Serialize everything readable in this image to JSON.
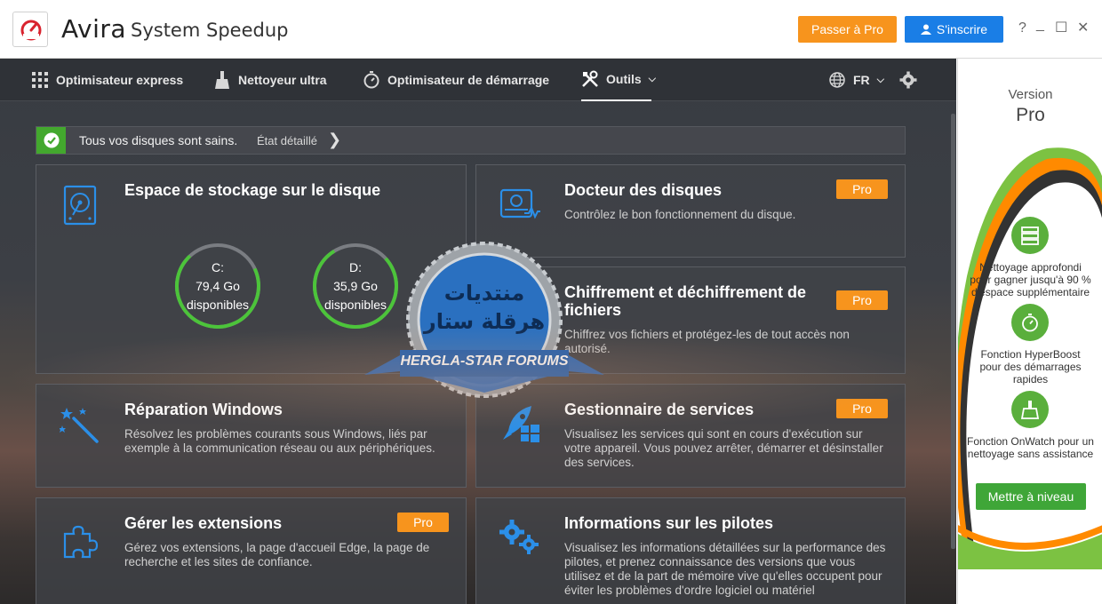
{
  "titlebar": {
    "brand": "Avira",
    "product": "System Speedup",
    "pro_button": "Passer à Pro",
    "signup_button": "S'inscrire",
    "help": "?",
    "minimize": "_",
    "maximize": "☐",
    "close": "✕"
  },
  "nav": {
    "items": [
      {
        "label": "Optimisateur express",
        "icon": "grid-icon"
      },
      {
        "label": "Nettoyeur ultra",
        "icon": "broom-icon"
      },
      {
        "label": "Optimisateur de démarrage",
        "icon": "stopwatch-icon"
      },
      {
        "label": "Outils",
        "icon": "tools-icon",
        "active": true
      }
    ],
    "language": "FR"
  },
  "status": {
    "text": "Tous vos disques sont sains.",
    "link": "État détaillé"
  },
  "cards": {
    "storage": {
      "title": "Espace de stockage sur le disque",
      "disks": [
        {
          "label": "C:",
          "free": "79,4 Go",
          "caption": "disponibles",
          "fill_fraction": 0.3
        },
        {
          "label": "D:",
          "free": "35,9 Go",
          "caption": "disponibles",
          "fill_fraction": 0.22
        }
      ]
    },
    "doctor": {
      "title": "Docteur des disques",
      "desc": "Contrôlez le bon fonctionnement du disque.",
      "badge": "Pro"
    },
    "encryption": {
      "title": "Chiffrement et déchiffrement de fichiers",
      "desc": "Chiffrez vos fichiers et protégez-les de tout accès non autorisé.",
      "badge": "Pro"
    },
    "repair": {
      "title": "Réparation Windows",
      "desc": "Résolvez les problèmes courants sous Windows, liés par exemple à la communication réseau ou aux périphériques."
    },
    "services": {
      "title": "Gestionnaire de services",
      "desc": "Visualisez les services qui sont en cours d'exécution sur votre appareil. Vous pouvez arrêter, démarrer et désinstaller des services.",
      "badge": "Pro"
    },
    "extensions": {
      "title": "Gérer les extensions",
      "desc": "Gérez vos extensions, la page d'accueil Edge, la page de recherche et les sites de confiance.",
      "badge": "Pro"
    },
    "drivers": {
      "title": "Informations sur les pilotes",
      "desc": "Visualisez les informations détaillées sur la performance des pilotes, et prenez connaissance des versions que vous utilisez et de la part de mémoire vive qu'elles occupent pour éviter les problèmes d'ordre logiciel ou matériel"
    }
  },
  "watermark": {
    "arabic_line1": "منتديات",
    "arabic_line2": "هرقلة ستار",
    "ribbon": "HERGLA-STAR FORUMS"
  },
  "promo": {
    "version_label": "Version",
    "pro_label": "Pro",
    "features": [
      {
        "icon": "server-clean-icon",
        "line1": "Nettoyage approfondi",
        "line2": "pour gagner jusqu'à 90 %",
        "line3": "d'espace supplémentaire"
      },
      {
        "icon": "stopwatch-icon",
        "line1": "Fonction HyperBoost",
        "line2": "pour des démarrages rapides",
        "line3": ""
      },
      {
        "icon": "broom-icon",
        "line1": "Fonction OnWatch pour un",
        "line2": "nettoyage sans assistance",
        "line3": ""
      }
    ],
    "upgrade_button": "Mettre à niveau"
  },
  "colors": {
    "accent_orange": "#f7941d",
    "accent_blue": "#1a7ee6",
    "accent_green": "#43a82e",
    "icon_blue": "#2b8fe8"
  }
}
